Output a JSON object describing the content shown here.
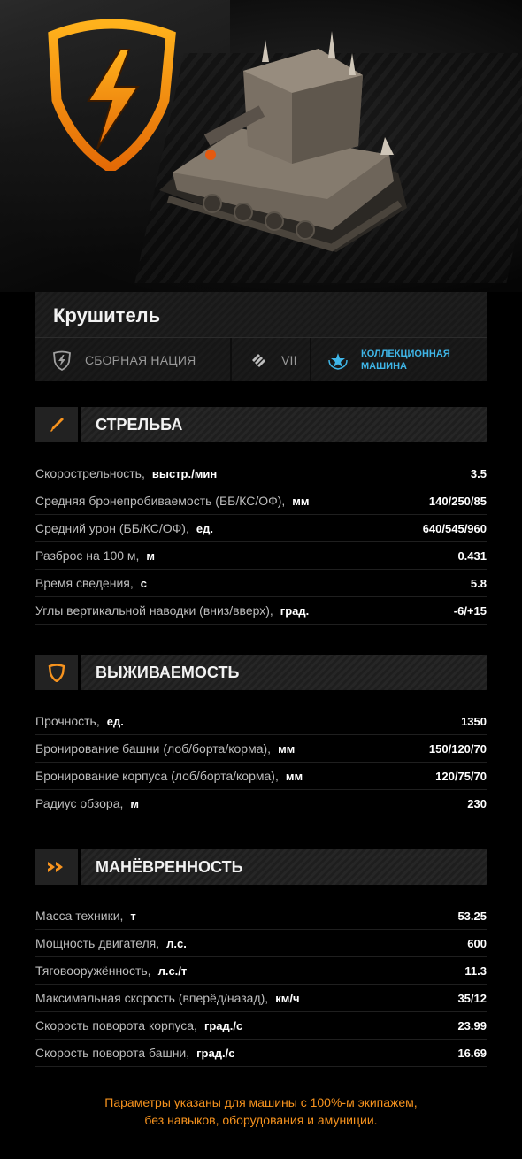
{
  "vehicle": {
    "name": "Крушитель",
    "nation": "СБОРНАЯ НАЦИЯ",
    "tier": "VII",
    "type_label_line1": "КОЛЛЕКЦИОННАЯ",
    "type_label_line2": "МАШИНА"
  },
  "colors": {
    "accent_orange": "#f7931e",
    "collection_blue": "#3fb6e8"
  },
  "sections": {
    "firepower": {
      "title": "СТРЕЛЬБА",
      "icon": "shell-icon",
      "rows": [
        {
          "label": "Скорострельность,",
          "unit": "выстр./мин",
          "value": "3.5"
        },
        {
          "label": "Средняя бронепробиваемость (ББ/КС/ОФ),",
          "unit": "мм",
          "value": "140/250/85"
        },
        {
          "label": "Средний урон (ББ/КС/ОФ),",
          "unit": "ед.",
          "value": "640/545/960"
        },
        {
          "label": "Разброс на 100 м,",
          "unit": "м",
          "value": "0.431"
        },
        {
          "label": "Время сведения,",
          "unit": "с",
          "value": "5.8"
        },
        {
          "label": "Углы вертикальной наводки (вниз/вверх),",
          "unit": "град.",
          "value": "-6/+15"
        }
      ]
    },
    "survivability": {
      "title": "ВЫЖИВАЕМОСТЬ",
      "icon": "shield-icon",
      "rows": [
        {
          "label": "Прочность,",
          "unit": "ед.",
          "value": "1350"
        },
        {
          "label": "Бронирование башни (лоб/борта/корма),",
          "unit": "мм",
          "value": "150/120/70"
        },
        {
          "label": "Бронирование корпуса (лоб/борта/корма),",
          "unit": "мм",
          "value": "120/75/70"
        },
        {
          "label": "Радиус обзора,",
          "unit": "м",
          "value": "230"
        }
      ]
    },
    "mobility": {
      "title": "МАНЁВРЕННОСТЬ",
      "icon": "double-chevron-icon",
      "rows": [
        {
          "label": "Масса техники,",
          "unit": "т",
          "value": "53.25"
        },
        {
          "label": "Мощность двигателя,",
          "unit": "л.с.",
          "value": "600"
        },
        {
          "label": "Тяговооружённость,",
          "unit": "л.с./т",
          "value": "11.3"
        },
        {
          "label": "Максимальная скорость (вперёд/назад),",
          "unit": "км/ч",
          "value": "35/12"
        },
        {
          "label": "Скорость поворота корпуса,",
          "unit": "град./с",
          "value": "23.99"
        },
        {
          "label": "Скорость поворота башни,",
          "unit": "град./с",
          "value": "16.69"
        }
      ]
    }
  },
  "footnote": {
    "line1": "Параметры указаны для машины с 100%-м экипажем,",
    "line2": "без навыков, оборудования и амуниции."
  }
}
